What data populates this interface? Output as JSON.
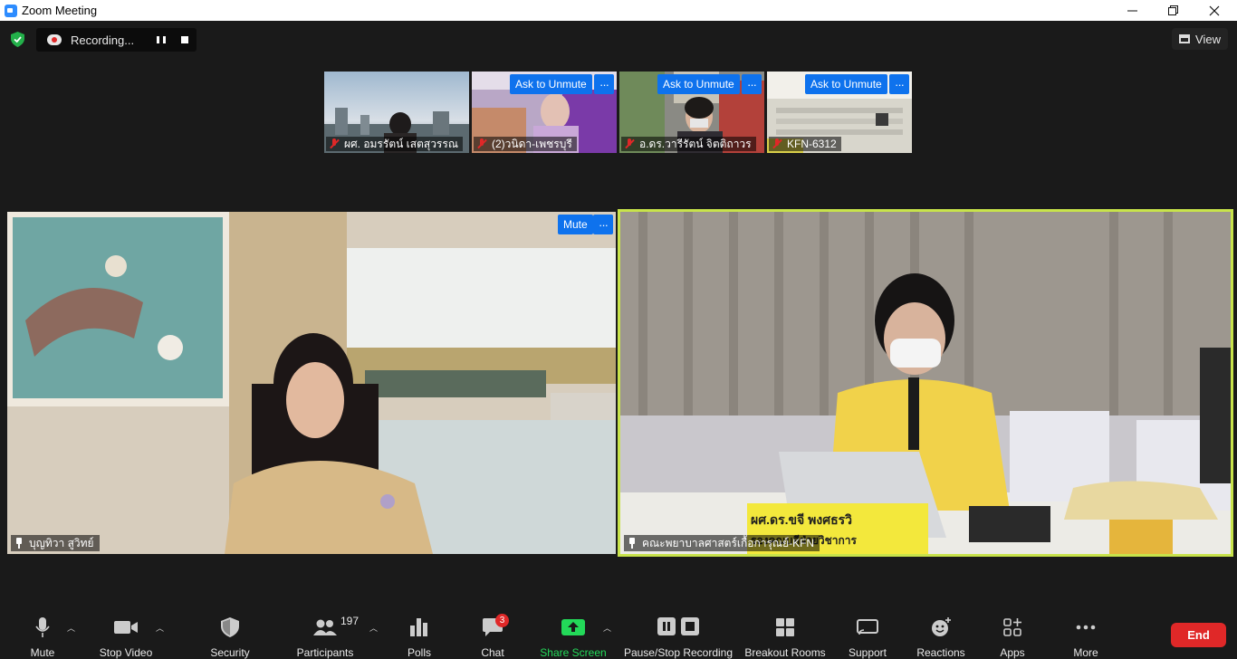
{
  "window": {
    "title": "Zoom Meeting"
  },
  "recording": {
    "label": "Recording..."
  },
  "view": {
    "label": "View"
  },
  "thumbnails": [
    {
      "name": "ผศ. อมรรัตน์  เสตสุวรรณ"
    },
    {
      "name": "(2)วนิดา-เพชรบุรี",
      "ask_label": "Ask to Unmute"
    },
    {
      "name": "อ.ดร.วารีรัตน์ จิตติถาวร",
      "ask_label": "Ask to Unmute"
    },
    {
      "name": "KFN-6312",
      "ask_label": "Ask to Unmute"
    }
  ],
  "main_tiles": [
    {
      "name": "บุญทิวา สูวิทย์",
      "mute_label": "Mute"
    },
    {
      "name": "คณะพยาบาลศาสตร์เกื้อการุณย์-KFN",
      "placard_line1": "ผศ.ดร.ขจี พงศธรวิ",
      "placard_line2": "รองคณบดีฝ่ายวิชาการ"
    }
  ],
  "more_label": "···",
  "toolbar": {
    "mute": "Mute",
    "stop_video": "Stop Video",
    "security": "Security",
    "participants": "Participants",
    "participants_count": "197",
    "polls": "Polls",
    "chat": "Chat",
    "chat_badge": "3",
    "share_screen": "Share Screen",
    "pause_stop_recording": "Pause/Stop Recording",
    "breakout_rooms": "Breakout Rooms",
    "support": "Support",
    "reactions": "Reactions",
    "apps": "Apps",
    "more": "More",
    "end": "End"
  },
  "colors": {
    "accent": "#0e72ed",
    "share_green": "#23d959",
    "end_red": "#e02828",
    "active_speaker": "#c8e34b"
  }
}
